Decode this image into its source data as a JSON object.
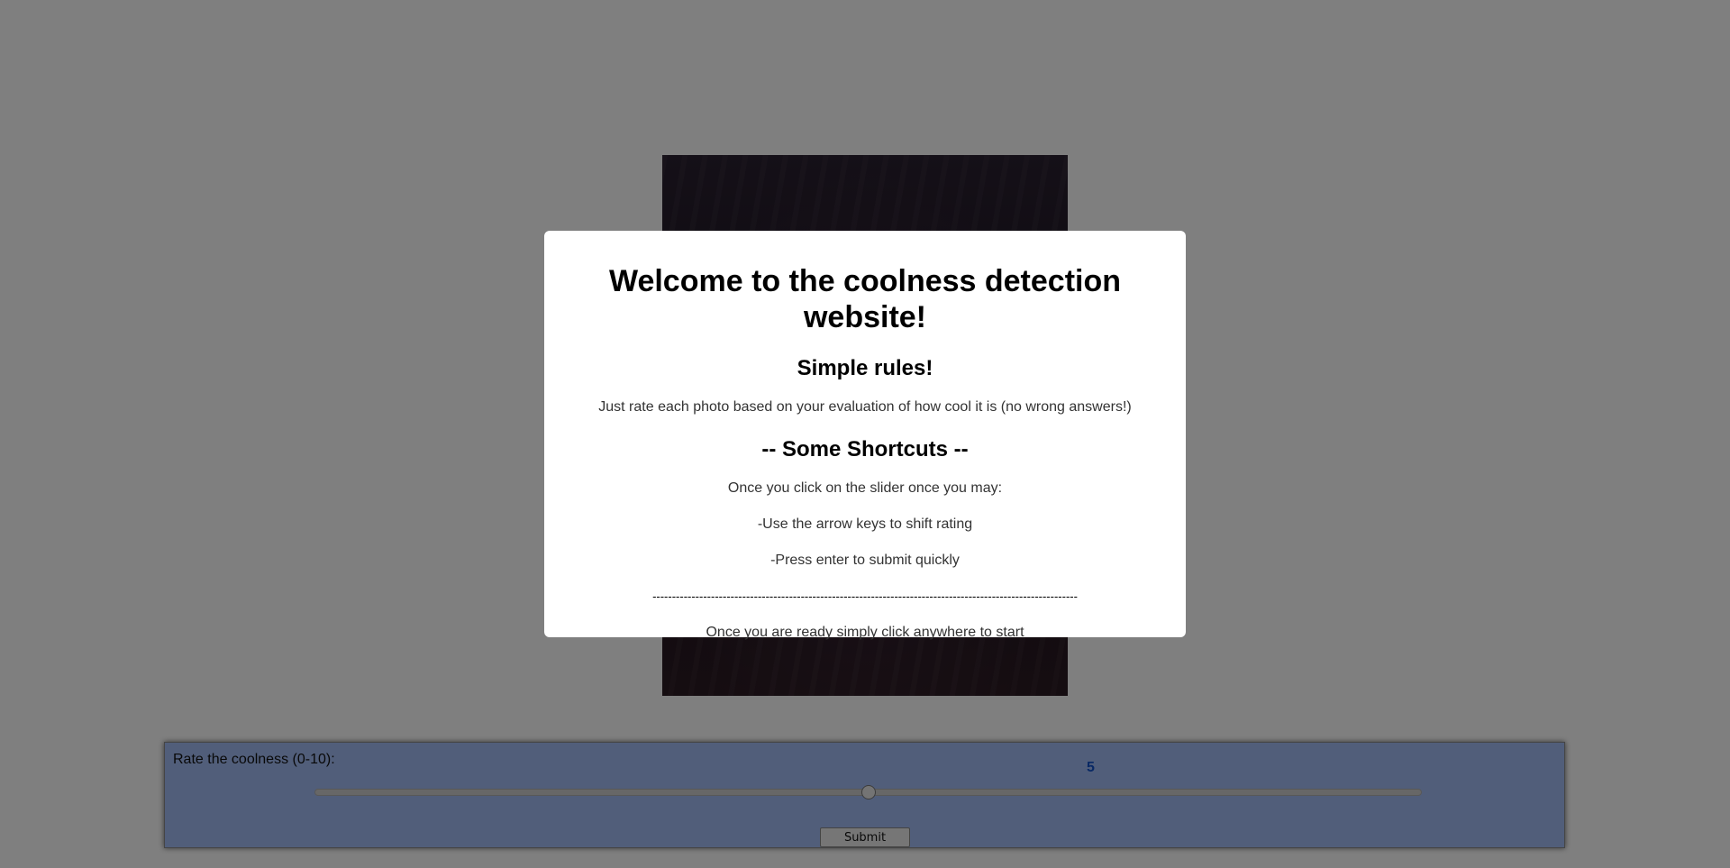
{
  "page": {
    "rating_label": "Rate the coolness (0-10):",
    "rating_value": "5",
    "slider": {
      "min": 0,
      "max": 10,
      "value": 5
    },
    "submit_label": "Submit",
    "colors": {
      "panel_background": "#a3bdf5",
      "rating_value": "#1050c8",
      "overlay": "rgba(0,0,0,0.5)"
    }
  },
  "modal": {
    "title": "Welcome to the coolness detection website!",
    "subtitle": "Simple rules!",
    "intro": "Just rate each photo based on your evaluation of how cool it is (no wrong answers!)",
    "shortcuts_heading": "-- Some Shortcuts --",
    "shortcut_intro": "Once you click on the slider once you may:",
    "shortcut_1": "-Use the arrow keys to shift rating",
    "shortcut_2": "-Press enter to submit quickly",
    "divider": "-------------------------------------------------------------------------------------------------------------",
    "footer": "Once you are ready simply click anywhere to start"
  }
}
